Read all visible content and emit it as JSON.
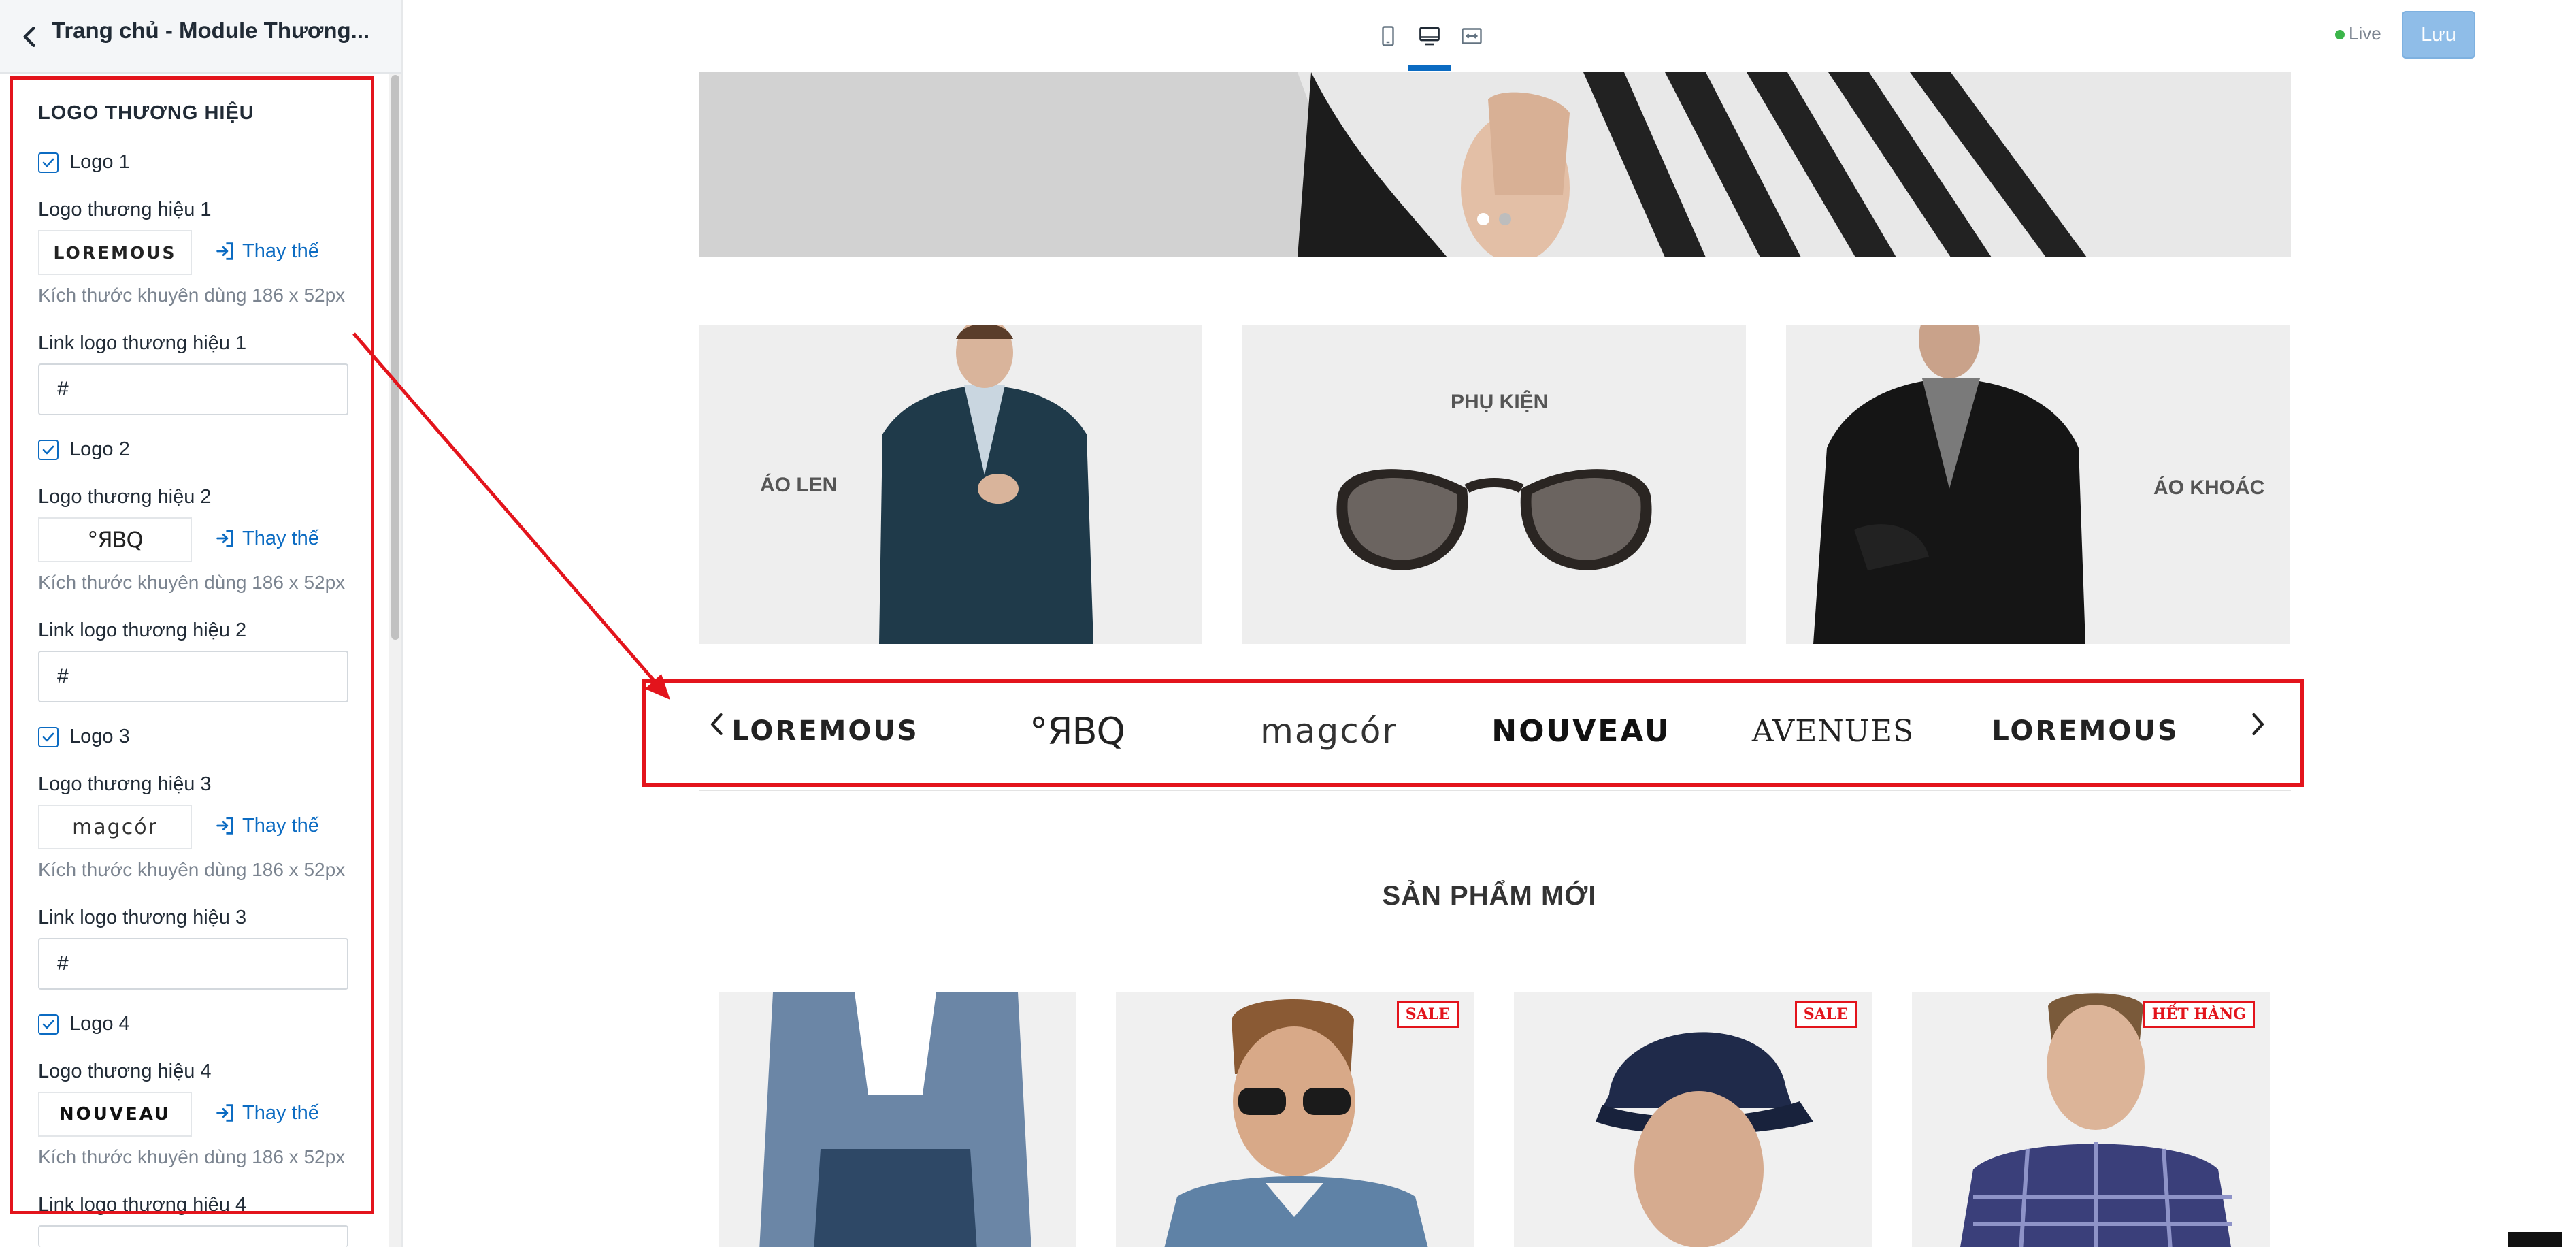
{
  "sidebar": {
    "title": "Trang chủ - Module Thương...",
    "section_title": "LOGO THƯƠNG HIỆU",
    "replace_label": "Thay thế",
    "size_hint": "Kích thước khuyên dùng 186 x 52px",
    "logos": [
      {
        "checkbox_label": "Logo 1",
        "image_label": "Logo thương hiệu 1",
        "logo_text": "LOREMOUS",
        "link_label": "Link logo thương hiệu 1",
        "link_value": "#"
      },
      {
        "checkbox_label": "Logo 2",
        "image_label": "Logo thương hiệu 2",
        "logo_text": "°ЯBQ",
        "link_label": "Link logo thương hiệu 2",
        "link_value": "#"
      },
      {
        "checkbox_label": "Logo 3",
        "image_label": "Logo thương hiệu 3",
        "logo_text": "magcór",
        "link_label": "Link logo thương hiệu 3",
        "link_value": "#"
      },
      {
        "checkbox_label": "Logo 4",
        "image_label": "Logo thương hiệu 4",
        "logo_text": "NOUVEAU",
        "link_label": "Link logo thương hiệu 4"
      }
    ]
  },
  "topbar": {
    "live_label": "Live",
    "save_label": "Lưu",
    "accent_color": "#0b6bc2",
    "live_color": "#3bb54a"
  },
  "preview": {
    "categories": [
      "ÁO LEN",
      "PHỤ KIỆN",
      "ÁO KHOÁC"
    ],
    "brand_logos": [
      "LOREMOUS",
      "°ЯBQ",
      "magcór",
      "NOUVEAU",
      "AVENUES",
      "LOREMOUS"
    ],
    "section_heading": "SẢN PHẨM MỚI",
    "product_badges": [
      "SALE",
      "SALE",
      "HẾT HÀNG"
    ],
    "highlight_color": "#e3141c"
  }
}
